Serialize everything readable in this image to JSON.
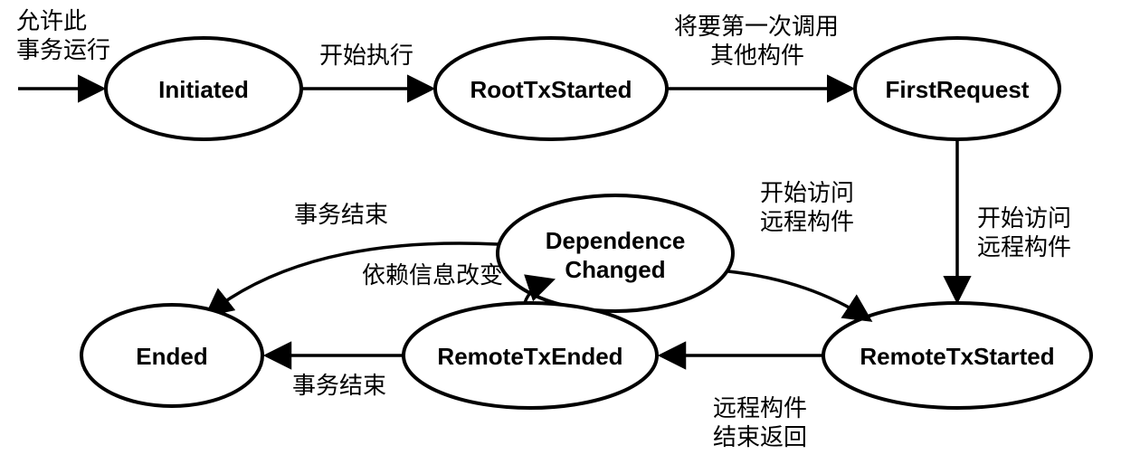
{
  "states": {
    "initiated": "Initiated",
    "rootTxStarted": "RootTxStarted",
    "firstRequest": "FirstRequest",
    "dependenceChanged": "Dependence",
    "dependenceChanged2": "Changed",
    "remoteTxStarted": "RemoteTxStarted",
    "remoteTxEnded": "RemoteTxEnded",
    "ended": "Ended"
  },
  "transitions": {
    "allowRun1": "允许此",
    "allowRun2": "事务运行",
    "startExec": "开始执行",
    "willFirstCall1": "将要第一次调用",
    "willFirstCall2": "其他构件",
    "startAccessRemote1": "开始访问",
    "startAccessRemote2": "远程构件",
    "startAccessRemote3": "开始访问",
    "startAccessRemote4": "远程构件",
    "remoteEndReturn1": "远程构件",
    "remoteEndReturn2": "结束返回",
    "depInfoChanged": "依赖信息改变",
    "txEnd1": "事务结束",
    "txEnd2": "事务结束"
  },
  "chart_data": {
    "type": "state-diagram",
    "title": "",
    "nodes": [
      {
        "id": "Initiated",
        "label": "Initiated"
      },
      {
        "id": "RootTxStarted",
        "label": "RootTxStarted"
      },
      {
        "id": "FirstRequest",
        "label": "FirstRequest"
      },
      {
        "id": "DependenceChanged",
        "label": "Dependence Changed"
      },
      {
        "id": "RemoteTxStarted",
        "label": "RemoteTxStarted"
      },
      {
        "id": "RemoteTxEnded",
        "label": "RemoteTxEnded"
      },
      {
        "id": "Ended",
        "label": "Ended"
      }
    ],
    "edges": [
      {
        "from": "_start",
        "to": "Initiated",
        "label": "允许此事务运行"
      },
      {
        "from": "Initiated",
        "to": "RootTxStarted",
        "label": "开始执行"
      },
      {
        "from": "RootTxStarted",
        "to": "FirstRequest",
        "label": "将要第一次调用其他构件"
      },
      {
        "from": "FirstRequest",
        "to": "RemoteTxStarted",
        "label": "开始访问远程构件"
      },
      {
        "from": "RemoteTxStarted",
        "to": "RemoteTxEnded",
        "label": "远程构件结束返回"
      },
      {
        "from": "RemoteTxEnded",
        "to": "DependenceChanged",
        "label": "依赖信息改变"
      },
      {
        "from": "DependenceChanged",
        "to": "RemoteTxStarted",
        "label": "开始访问远程构件"
      },
      {
        "from": "DependenceChanged",
        "to": "Ended",
        "label": "事务结束"
      },
      {
        "from": "RemoteTxEnded",
        "to": "Ended",
        "label": "事务结束"
      }
    ]
  }
}
